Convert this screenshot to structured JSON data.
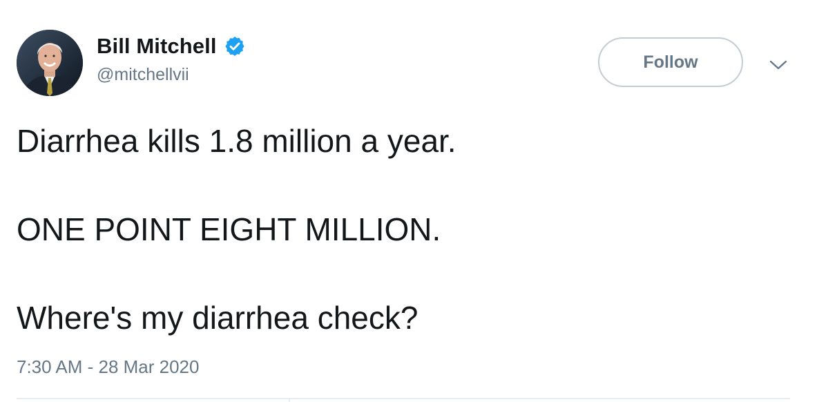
{
  "author": {
    "display_name": "Bill Mitchell",
    "handle": "@mitchellvii",
    "verified": true,
    "avatar_icon": "profile-photo"
  },
  "actions": {
    "follow_label": "Follow",
    "menu_icon": "chevron-down-icon"
  },
  "tweet": {
    "lines": [
      "Diarrhea kills 1.8 million a year.",
      "ONE POINT EIGHT MILLION.",
      "Where's my diarrhea check?"
    ],
    "timestamp": "7:30 AM - 28 Mar 2020"
  },
  "colors": {
    "verified_badge": "#1da1f2",
    "text_primary": "#14171a",
    "text_secondary": "#657786",
    "button_border": "#c4ccd3"
  }
}
